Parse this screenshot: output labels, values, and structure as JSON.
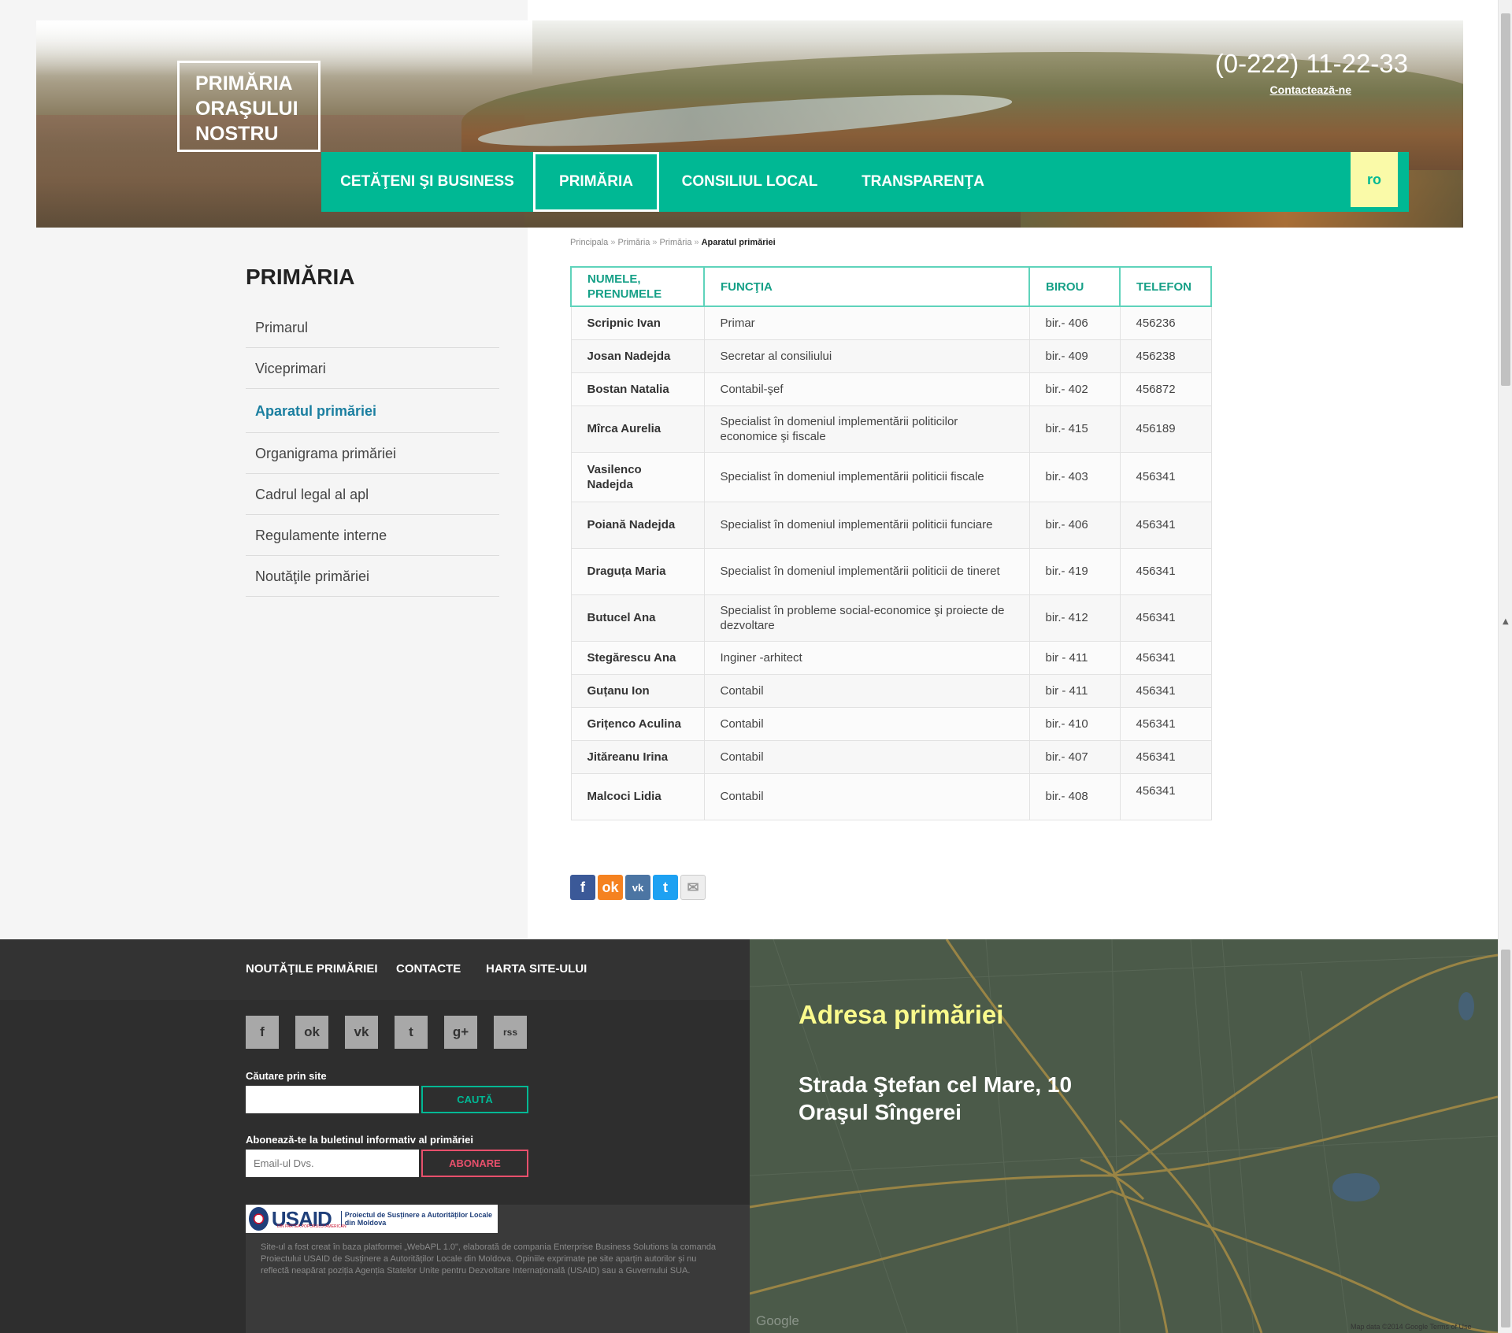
{
  "header": {
    "logo_lines": [
      "PRIMĂRIA",
      "ORAŞULUI",
      "NOSTRU"
    ],
    "phone": "(0-222) 11-22-33",
    "contact_link": "Contactează-ne"
  },
  "nav": {
    "items": [
      "CETĂŢENI ŞI BUSINESS",
      "PRIMĂRIA",
      "CONSILIUL LOCAL",
      "TRANSPARENŢA"
    ],
    "active": "PRIMĂRIA",
    "language": "ro",
    "accent_color": "#00b894"
  },
  "breadcrumb": [
    "Principala",
    "Primăria",
    "Primăria",
    "Aparatul primăriei"
  ],
  "sidebar": {
    "title": "PRIMĂRIA",
    "items": [
      "Primarul",
      "Viceprimari",
      "Aparatul primăriei",
      "Organigrama primăriei",
      "Cadrul legal al apl",
      "Regulamente interne",
      "Noutăţile primăriei"
    ],
    "active": "Aparatul primăriei"
  },
  "table": {
    "headers": [
      "NUMELE, PRENUMELE",
      "FUNCŢIA",
      "BIROU",
      "TELEFON"
    ],
    "rows": [
      {
        "name": "Scripnic Ivan",
        "function": "Primar",
        "office": "bir.- 406",
        "phone": "456236"
      },
      {
        "name": "Josan Nadejda",
        "function": "Secretar al consiliului",
        "office": "bir.- 409",
        "phone": "456238"
      },
      {
        "name": "Bostan Natalia",
        "function": "Contabil-şef",
        "office": "bir.- 402",
        "phone": "456872"
      },
      {
        "name": "Mîrca Aurelia",
        "function": "Specialist în domeniul implementării politicilor economice şi fiscale",
        "office": "bir.- 415",
        "phone": "456189"
      },
      {
        "name": "Vasilenco Nadejda",
        "function": "Specialist în domeniul implementării politicii fiscale",
        "office": "bir.- 403",
        "phone": "456341"
      },
      {
        "name": "Poiană Nadejda",
        "function": "Specialist în domeniul implementării politicii funciare",
        "office": "bir.- 406",
        "phone": "456341"
      },
      {
        "name": "Draguța Maria",
        "function": "Specialist în domeniul implementării politicii de tineret",
        "office": "bir.- 419",
        "phone": "456341"
      },
      {
        "name": "Butucel Ana",
        "function": "Specialist în probleme social-economice şi proiecte de dezvoltare",
        "office": "bir.- 412",
        "phone": "456341"
      },
      {
        "name": "Stegărescu Ana",
        "function": "Inginer -arhitect",
        "office": "bir - 411",
        "phone": "456341"
      },
      {
        "name": "Guțanu Ion",
        "function": "Contabil",
        "office": "bir - 411",
        "phone": "456341"
      },
      {
        "name": "Grițenco Aculina",
        "function": "Contabil",
        "office": "bir.- 410",
        "phone": "456341"
      },
      {
        "name": "Jităreanu Irina",
        "function": "Contabil",
        "office": "bir.- 407",
        "phone": "456341"
      },
      {
        "name": "Malcoci Lidia",
        "function": "Contabil",
        "office": "bir.- 408",
        "phone": "456341"
      }
    ]
  },
  "share": {
    "icons": [
      "facebook-icon",
      "odnoklassniki-icon",
      "vk-icon",
      "twitter-icon",
      "email-icon"
    ],
    "glyphs": [
      "f",
      "ok",
      "vk",
      "t",
      "✉"
    ]
  },
  "footer": {
    "nav": [
      "NOUTĂŢILE PRIMĂRIEI",
      "CONTACTE",
      "HARTA SITE-ULUI"
    ],
    "social_glyphs": [
      "f",
      "ok",
      "vk",
      "t",
      "g+",
      "rss"
    ],
    "search_label": "Căutare prin site",
    "search_button": "CAUTĂ",
    "subscribe_label": "Abonează-te la buletinul informativ al primăriei",
    "subscribe_placeholder": "Email-ul Dvs.",
    "subscribe_button": "ABONARE",
    "usaid_brand": "USAID",
    "usaid_sub": "DIN PARTEA POPORULUI AMERICAN",
    "usaid_project": "Proiectul de Susținere a Autorităților Locale din Moldova",
    "credits": "Site-ul a fost creat în baza platformei „WebAPL 1.0\", elaborată de compania Enterprise Business Solutions la comanda Proiectului USAID de Susținere a Autorităților Locale din Moldova. Opiniile exprimate pe site aparțin autorilor și nu reflectă neapărat poziția Agenția Statelor Unite pentru Dezvoltare Internațională (USAID) sau a Guvernului SUA."
  },
  "map": {
    "title": "Adresa primăriei",
    "address_line1": "Strada Ştefan cel Mare, 10",
    "address_line2": "Oraşul Sîngerei",
    "credit": "Map data ©2014 Google   Terms of Use",
    "google": "Google"
  }
}
